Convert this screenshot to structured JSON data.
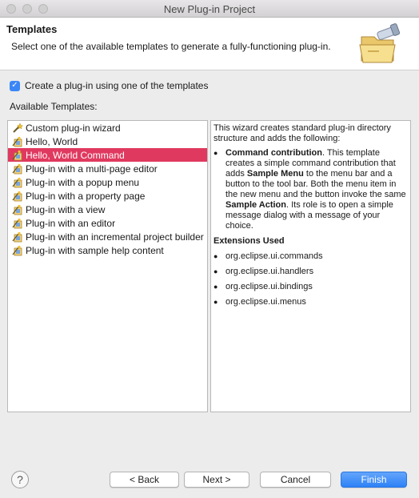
{
  "window": {
    "title": "New Plug-in Project"
  },
  "header": {
    "title": "Templates",
    "description": "Select one of the available templates to generate a fully-functioning plug-in.",
    "icon": "wizard-folder-icon"
  },
  "options": {
    "create_checkbox_label": "Create a plug-in using one of the templates",
    "create_checked": true
  },
  "available_label": "Available Templates:",
  "templates": [
    {
      "label": "Custom plug-in wizard",
      "icon": "wand-icon"
    },
    {
      "label": "Hello, World",
      "icon": "plugin-template-icon"
    },
    {
      "label": "Hello, World Command",
      "icon": "plugin-template-icon",
      "selected": true
    },
    {
      "label": "Plug-in with a multi-page editor",
      "icon": "plugin-template-icon"
    },
    {
      "label": "Plug-in with a popup menu",
      "icon": "plugin-template-icon"
    },
    {
      "label": "Plug-in with a property page",
      "icon": "plugin-template-icon"
    },
    {
      "label": "Plug-in with a view",
      "icon": "plugin-template-icon"
    },
    {
      "label": "Plug-in with an editor",
      "icon": "plugin-template-icon"
    },
    {
      "label": "Plug-in with an incremental project builder",
      "icon": "plugin-template-icon"
    },
    {
      "label": "Plug-in with sample help content",
      "icon": "plugin-template-icon"
    }
  ],
  "description": {
    "intro": "This wizard creates standard plug-in directory structure and adds the following:",
    "bullet": {
      "b1": "Command contribution",
      "t1": ". This template creates a simple command contribution that adds ",
      "b2": "Sample Menu",
      "t2": " to the menu bar and a button to the tool bar. Both the menu item in the new menu and the button invoke the same ",
      "b3": "Sample Action",
      "t3": ". Its role is to open a simple message dialog with a message of your choice."
    },
    "extensions_heading": "Extensions Used",
    "extensions": [
      "org.eclipse.ui.commands",
      "org.eclipse.ui.handlers",
      "org.eclipse.ui.bindings",
      "org.eclipse.ui.menus"
    ]
  },
  "buttons": {
    "help": "?",
    "back": "< Back",
    "next": "Next >",
    "cancel": "Cancel",
    "finish": "Finish"
  }
}
